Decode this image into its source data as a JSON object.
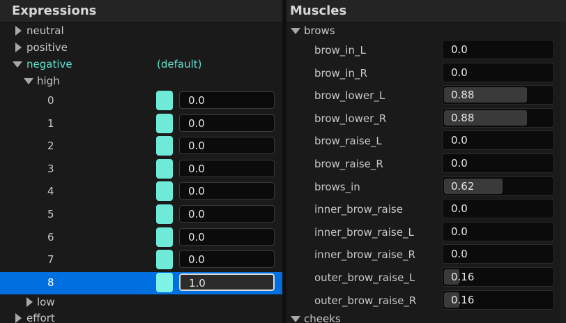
{
  "expressions": {
    "title": "Expressions",
    "tree": {
      "neutral": "neutral",
      "positive": "positive",
      "negative": "negative",
      "negative_default": "(default)",
      "high": "high",
      "low": "low",
      "effort": "effort"
    },
    "high_items": [
      {
        "index": "0",
        "value": "0.0"
      },
      {
        "index": "1",
        "value": "0.0"
      },
      {
        "index": "2",
        "value": "0.0"
      },
      {
        "index": "3",
        "value": "0.0"
      },
      {
        "index": "4",
        "value": "0.0"
      },
      {
        "index": "5",
        "value": "0.0"
      },
      {
        "index": "6",
        "value": "0.0"
      },
      {
        "index": "7",
        "value": "0.0"
      },
      {
        "index": "8",
        "value": "1.0"
      }
    ],
    "selected_index": "8",
    "swatch_color": "#6fe9d8"
  },
  "muscles": {
    "title": "Muscles",
    "groups": {
      "brows": "brows",
      "cheeks": "cheeks"
    },
    "items": [
      {
        "label": "brow_in_L",
        "value": "0.0",
        "level": 0
      },
      {
        "label": "brow_in_R",
        "value": "0.0",
        "level": 0
      },
      {
        "label": "brow_lower_L",
        "value": "0.88",
        "level": 0.88
      },
      {
        "label": "brow_lower_R",
        "value": "0.88",
        "level": 0.88
      },
      {
        "label": "brow_raise_L",
        "value": "0.0",
        "level": 0
      },
      {
        "label": "brow_raise_R",
        "value": "0.0",
        "level": 0
      },
      {
        "label": "brows_in",
        "value": "0.62",
        "level": 0.62
      },
      {
        "label": "inner_brow_raise",
        "value": "0.0",
        "level": 0
      },
      {
        "label": "inner_brow_raise_L",
        "value": "0.0",
        "level": 0
      },
      {
        "label": "inner_brow_raise_R",
        "value": "0.0",
        "level": 0
      },
      {
        "label": "outer_brow_raise_L",
        "value": "0.16",
        "level": 0.16
      },
      {
        "label": "outer_brow_raise_R",
        "value": "0.16",
        "level": 0.16
      }
    ]
  }
}
